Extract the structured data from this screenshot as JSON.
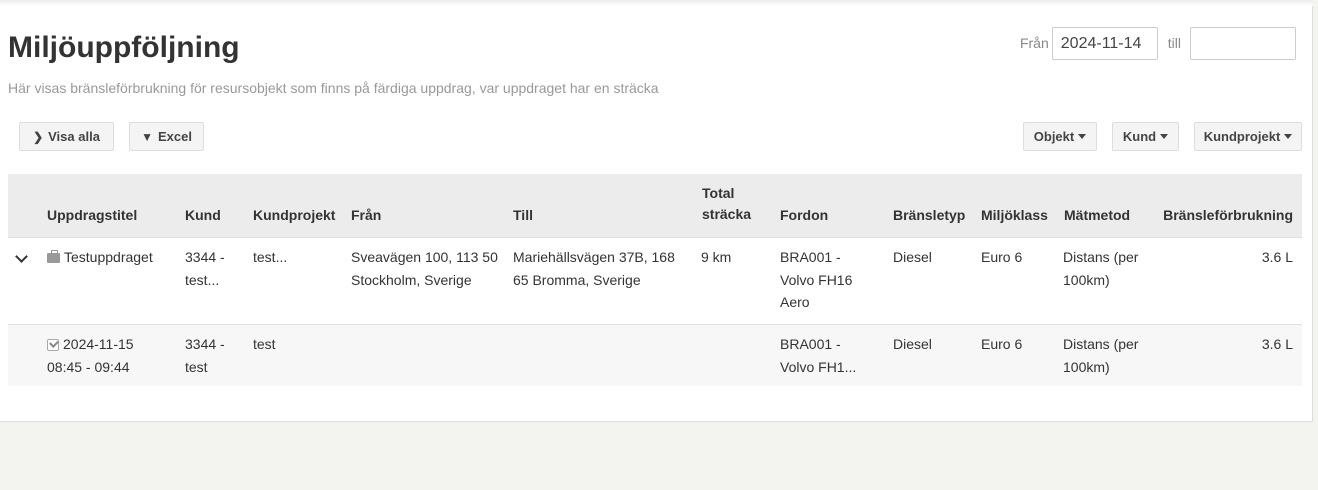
{
  "header": {
    "title": "Miljöuppföljning",
    "subtitle": "Här visas bränsleförbrukning för resursobjekt som finns på färdiga uppdrag, var uppdraget har en sträcka"
  },
  "date_range": {
    "from_label": "Från",
    "from_value": "2024-11-14",
    "to_label": "till",
    "to_value": ""
  },
  "toolbar": {
    "show_all_label": "Visa alla",
    "excel_label": "Excel",
    "object_label": "Objekt",
    "customer_label": "Kund",
    "customer_project_label": "Kundprojekt"
  },
  "table": {
    "headers": {
      "title": "Uppdragstitel",
      "customer": "Kund",
      "customer_project": "Kundprojekt",
      "from": "Från",
      "to": "Till",
      "total_distance_line1": "Total",
      "total_distance_line2": "sträcka",
      "vehicle": "Fordon",
      "fuel_type": "Bränsletyp",
      "env_class": "Miljöklass",
      "method": "Mätmetod",
      "consumption": "Bränsleförbrukning"
    },
    "rows": [
      {
        "title": "Testuppdraget",
        "customer_line1": "3344 -",
        "customer_line2": "test...",
        "customer_project": "test...",
        "from_line1": "Sveavägen 100, 113 50",
        "from_line2": "Stockholm, Sverige",
        "to_line1": "Mariehällsvägen 37B, 168",
        "to_line2": "65 Bromma, Sverige",
        "distance": "9 km",
        "vehicle_line1": "BRA001 -",
        "vehicle_line2": "Volvo FH16",
        "vehicle_line3": "Aero",
        "fuel_type": "Diesel",
        "env_class": "Euro 6",
        "method_line1": "Distans (per",
        "method_line2": "100km)",
        "consumption": "3.6 L"
      },
      {
        "title_line1": "2024-11-15",
        "title_line2": "08:45 - 09:44",
        "customer_line1": "3344 -",
        "customer_line2": "test",
        "customer_project": "test",
        "vehicle_line1": "BRA001 -",
        "vehicle_line2": "Volvo FH1...",
        "fuel_type": "Diesel",
        "env_class": "Euro 6",
        "method_line1": "Distans (per",
        "method_line2": "100km)",
        "consumption": "3.6 L"
      }
    ]
  }
}
